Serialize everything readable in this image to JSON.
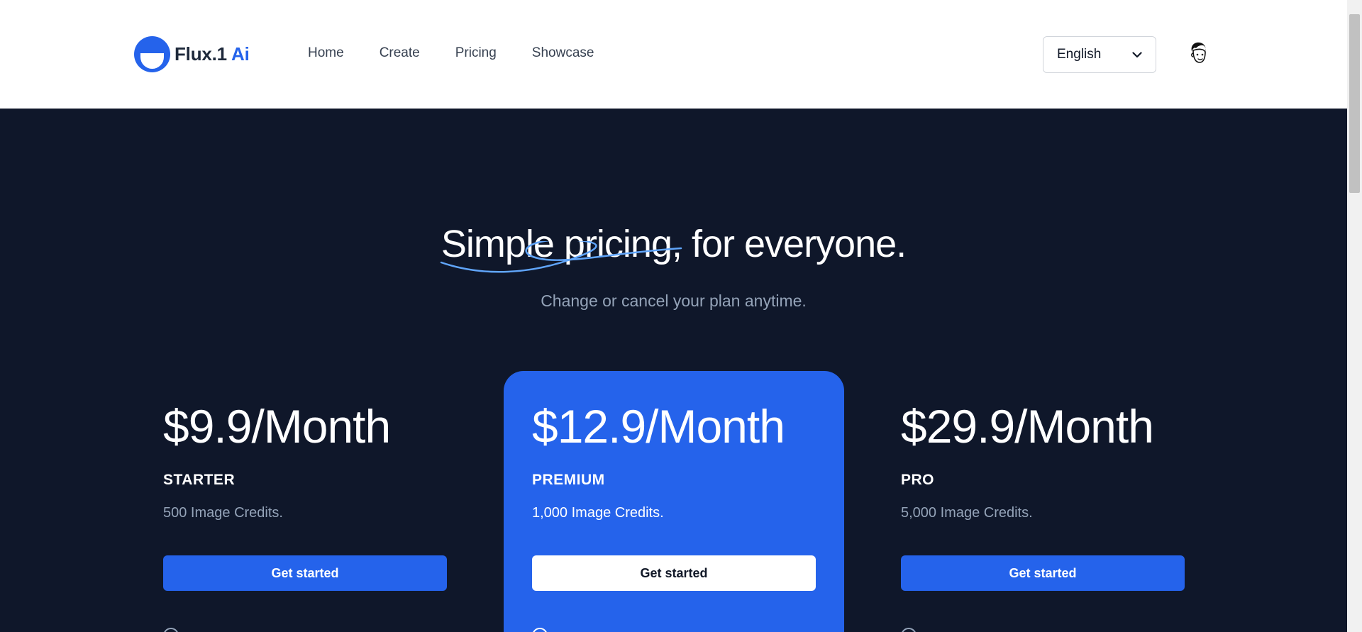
{
  "header": {
    "logo_text": "Flux.1",
    "logo_accent": "Ai",
    "nav": [
      {
        "label": "Home"
      },
      {
        "label": "Create"
      },
      {
        "label": "Pricing"
      },
      {
        "label": "Showcase"
      }
    ],
    "language": {
      "selected": "English"
    }
  },
  "hero": {
    "title": "Simple pricing, for everyone.",
    "subtitle": "Change or cancel your plan anytime."
  },
  "plans": [
    {
      "price": "$9.9/Month",
      "tier": "STARTER",
      "credits": "500 Image Credits.",
      "cta": "Get started",
      "featured": false
    },
    {
      "price": "$12.9/Month",
      "tier": "PREMIUM",
      "credits": "1,000 Image Credits.",
      "cta": "Get started",
      "featured": true
    },
    {
      "price": "$29.9/Month",
      "tier": "PRO",
      "credits": "5,000 Image Credits.",
      "cta": "Get started",
      "featured": false
    }
  ],
  "colors": {
    "primary": "#2563eb",
    "page_background": "#0f172a",
    "header_background": "#ffffff",
    "muted_text": "#94a3b8"
  },
  "icons": {
    "logo": "logo-icon",
    "language_chevron": "chevron-down-icon",
    "avatar": "avatar-icon",
    "feature_check": "check-circle-icon"
  }
}
